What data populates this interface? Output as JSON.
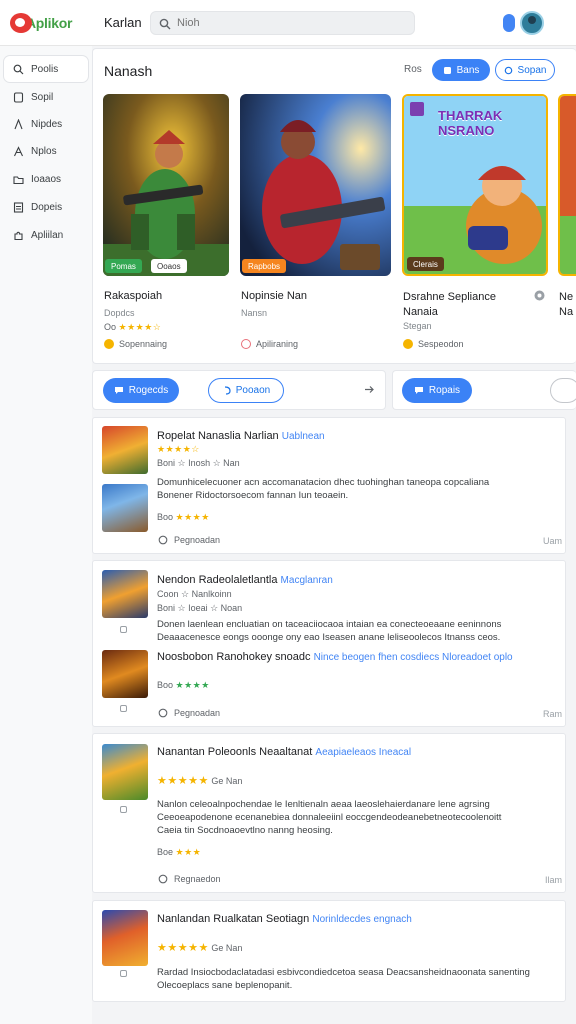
{
  "header": {
    "logo_text": "Aplikor",
    "app_title": "Karlan",
    "search_placeholder": "Nioh"
  },
  "sidebar": {
    "items": [
      {
        "label": "Poolis",
        "icon": "search-icon"
      },
      {
        "label": "Sopil",
        "icon": "file-icon"
      },
      {
        "label": "Nipdes",
        "icon": "bookmark-icon"
      },
      {
        "label": "Nplos",
        "icon": "text-icon"
      },
      {
        "label": "Ioaaos",
        "icon": "folder-icon"
      },
      {
        "label": "Dopeis",
        "icon": "document-icon"
      },
      {
        "label": "Apliilan",
        "icon": "puzzle-icon"
      }
    ]
  },
  "featured": {
    "title": "Nanash",
    "sort_label": "Ros",
    "filter_button": "Bans",
    "open_button": "Sopan",
    "tiles": [
      {
        "name": "Rakaspoiah",
        "sub": "Dopdcs",
        "meta": "Oo",
        "stars": "★★★★☆",
        "footer": "Sopennaing",
        "badge1": "Pomas",
        "badge2": "Ooaos"
      },
      {
        "name": "Nopinsie Nan",
        "sub": "Nansn",
        "meta": "",
        "stars": "",
        "footer": "Apiliraning",
        "badge1": "Rapbobs",
        "badge2": ""
      },
      {
        "name": "Dsrahne Sepliance Nanaia",
        "sub": "Stegan",
        "meta": "",
        "stars": "",
        "footer": "Sespeodon",
        "badge1": "Clerais",
        "badge2": "",
        "art_title": "THARRAK NSRANO"
      },
      {
        "name": "Ne Na",
        "sub": "",
        "meta": "",
        "stars": "",
        "footer": "",
        "badge1": "",
        "badge2": ""
      }
    ]
  },
  "actions": {
    "btn1": "Rogecds",
    "btn2": "Pooaon",
    "btn3": "Ropais"
  },
  "reviews": [
    {
      "title": "Ropelat Nanaslia Narlian",
      "link": "Uablnean",
      "meta1": "★★★★☆",
      "meta2": "Boni ☆ Inosh ☆ Nan",
      "body": [
        "Domunhicelecuoner acn accomanatacion dhec tuohinghan taneopa copcaliana",
        "Bonener Ridoctorsoecom fannan Iun teoaein."
      ],
      "sub_meta": "Boo",
      "sub_stars": "★★★★",
      "footer": "Pegnoadan",
      "right": "Uam"
    },
    {
      "title": "Nendon Radeolaletlantla",
      "link": "Macglanran",
      "meta1": "Coon ☆ Nanlkoinn",
      "meta2": "Boni ☆ Ioeai ☆ Noan",
      "body": [
        "Donen laenlean encluatian on taceaciiocaoa intaian ea conecteoeaane eeninnons",
        "Deaaacenesce eongs ooonge ony eao Iseasen anane leliseoolecos Itnanss ceos."
      ],
      "sub_title": "Noosbobon Ranohokey snoadc",
      "sub_link": "Nince beogen fhen cosdiecs Nloreadoet oplo",
      "sub_meta": "Boo",
      "sub_stars": "★★★★",
      "footer": "Pegnoadan",
      "right": "Ram"
    },
    {
      "title": "Nanantan Poleoonls Neaaltanat",
      "link": "Aeapiaeleaos Ineacal",
      "meta1": "★★★★★",
      "meta2": "Ge Nan",
      "body": [
        "Nanlon celeoalnpochendae le Ienltienaln aeaa laeoslehaierdanare lene agrsing",
        "Ceeoeapodenone ecenanebiea donnaleeiinl eoccgendeodeanebetneotecoolenoitt",
        "Caeia tin Socdnoaoevtlno nanng heosing."
      ],
      "sub_meta": "Boe",
      "sub_stars": "★★★",
      "footer": "Regnaedon",
      "right": "Ilam"
    },
    {
      "title": "Nanlandan Rualkatan Seotiagn",
      "link": "Norinldecdes engnach",
      "meta1": "★★★★★",
      "meta2": "Ge Nan",
      "body": [
        "Rardad Insiocbodaclatadasi esbivcondiedcetoa seasa Deacsansheidnaoonata sanenting",
        "Olecoeplacs sane beplenopanit."
      ]
    }
  ]
}
